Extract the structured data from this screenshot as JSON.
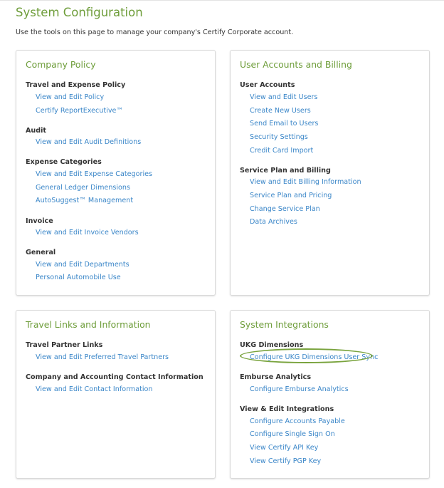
{
  "page": {
    "title": "System Configuration",
    "description": "Use the tools on this page to manage your company's Certify Corporate account."
  },
  "company_policy": {
    "title": "Company Policy",
    "sections": [
      {
        "title": "Travel and Expense Policy",
        "links": [
          "View and Edit Policy",
          "Certify ReportExecutive™"
        ]
      },
      {
        "title": "Audit",
        "links": [
          "View and Edit Audit Definitions"
        ]
      },
      {
        "title": "Expense Categories",
        "links": [
          "View and Edit Expense Categories",
          "General Ledger Dimensions",
          "AutoSuggest™ Management"
        ]
      },
      {
        "title": "Invoice",
        "links": [
          "View and Edit Invoice Vendors"
        ]
      },
      {
        "title": "General",
        "links": [
          "View and Edit Departments",
          "Personal Automobile Use"
        ]
      }
    ]
  },
  "user_accounts": {
    "title": "User Accounts and Billing",
    "sections": [
      {
        "title": "User Accounts",
        "links": [
          "View and Edit Users",
          "Create New Users",
          "Send Email to Users",
          "Security Settings",
          "Credit Card Import"
        ]
      },
      {
        "title": "Service Plan and Billing",
        "links": [
          "View and Edit Billing Information",
          "Service Plan and Pricing",
          "Change Service Plan",
          "Data Archives"
        ]
      }
    ]
  },
  "travel_links": {
    "title": "Travel Links and Information",
    "sections": [
      {
        "title": "Travel Partner Links",
        "links": [
          "View and Edit Preferred Travel Partners"
        ]
      },
      {
        "title": "Company and Accounting Contact Information",
        "links": [
          "View and Edit Contact Information"
        ]
      }
    ]
  },
  "system_integrations": {
    "title": "System Integrations",
    "sections": [
      {
        "title": "UKG Dimensions",
        "links": [
          "Configure UKG Dimensions User Sync"
        ]
      },
      {
        "title": "Emburse Analytics",
        "links": [
          "Configure Emburse Analytics"
        ]
      },
      {
        "title": "View & Edit Integrations",
        "links": [
          "Configure Accounts Payable",
          "Configure Single Sign On",
          "View Certify API Key",
          "View Certify PGP Key"
        ]
      }
    ]
  },
  "colors": {
    "accent_green": "#6e9d3a",
    "link_blue": "#3a86c8",
    "highlight_ring": "#79a33d"
  }
}
